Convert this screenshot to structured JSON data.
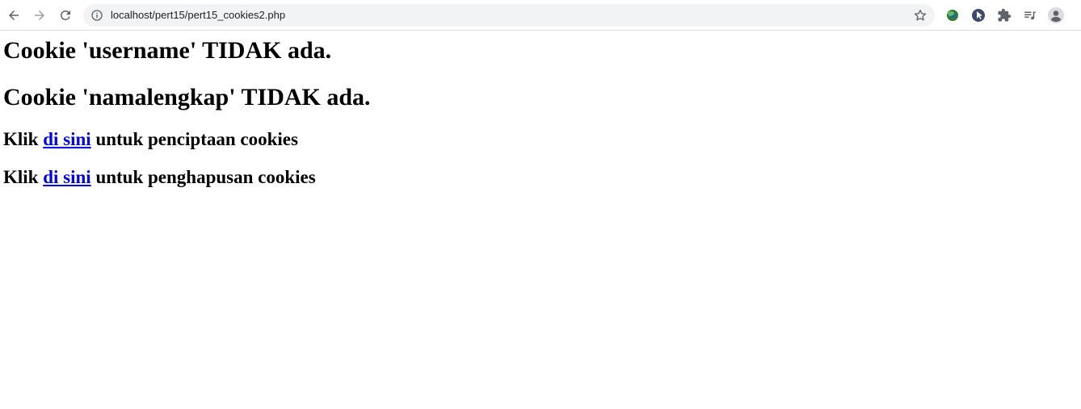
{
  "browser": {
    "url": "localhost/pert15/pert15_cookies2.php",
    "icons": [
      "back-arrow-icon",
      "forward-arrow-icon",
      "reload-icon",
      "site-info-icon",
      "bookmark-star-icon",
      "idm-extension-icon",
      "cursor-extension-icon",
      "extensions-puzzle-icon",
      "reading-list-icon",
      "profile-avatar-icon"
    ]
  },
  "page": {
    "heading1": "Cookie 'username' TIDAK ada.",
    "heading2": "Cookie 'namalengkap' TIDAK ada.",
    "line1": {
      "prefix": "Klik ",
      "link": "di sini",
      "suffix": " untuk penciptaan cookies"
    },
    "line2": {
      "prefix": "Klik ",
      "link": "di sini",
      "suffix": " untuk penghapusan cookies"
    }
  },
  "colors": {
    "link": "#0000ee",
    "omnibox_bg": "#f1f3f4",
    "icon": "#5f6368"
  }
}
